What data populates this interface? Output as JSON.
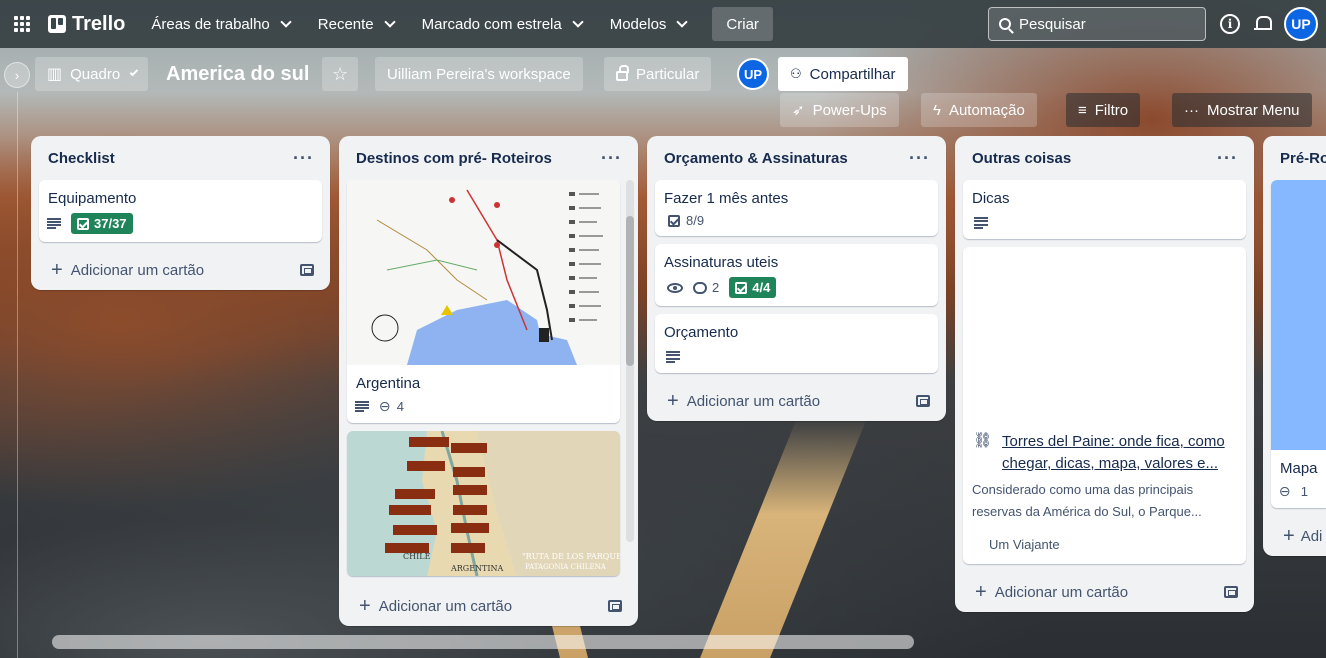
{
  "nav": {
    "logo_text": "Trello",
    "menu": [
      {
        "label": "Áreas de trabalho"
      },
      {
        "label": "Recente"
      },
      {
        "label": "Marcado com estrela"
      },
      {
        "label": "Modelos"
      }
    ],
    "create_label": "Criar",
    "search_placeholder": "Pesquisar",
    "avatar_initials": "UP"
  },
  "board": {
    "view_label": "Quadro",
    "title": "America do sul",
    "workspace_label": "Uilliam Pereira's workspace",
    "visibility_label": "Particular",
    "member_initials": "UP",
    "share_label": "Compartilhar",
    "powerups_label": "Power-Ups",
    "automation_label": "Automação",
    "filter_label": "Filtro",
    "menu_label": "Mostrar Menu"
  },
  "lists": {
    "add_card_label": "Adicionar um cartão",
    "checklist": {
      "title": "Checklist",
      "cards": [
        {
          "title": "Equipamento",
          "checklist": "37/37"
        }
      ]
    },
    "destinos": {
      "title": "Destinos com pré- Roteiros",
      "cards": [
        {
          "title": "Argentina",
          "attachments": "4"
        }
      ],
      "map2_labels": [
        "\"RUTA DE LOS PARQUES\"",
        "PATAGONIA CHILENA",
        "CHILE",
        "ARGENTINA"
      ]
    },
    "orcamento": {
      "title": "Orçamento & Assinaturas",
      "cards": [
        {
          "title": "Fazer 1 mês antes",
          "checklist": "8/9"
        },
        {
          "title": "Assinaturas uteis",
          "comments": "2",
          "checklist": "4/4"
        },
        {
          "title": "Orçamento"
        }
      ]
    },
    "outras": {
      "title": "Outras coisas",
      "cards": [
        {
          "title": "Dicas"
        },
        {
          "link_title": "Torres del Paine: onde fica, como chegar, dicas, mapa, valores e...",
          "link_desc": "Considerado como uma das principais reservas da América do Sul, o Parque...",
          "link_source": "Um Viajante"
        }
      ]
    },
    "preroteiro": {
      "title": "Pré-Ro",
      "cards": [
        {
          "title": "Mapa",
          "attachments": "1"
        }
      ],
      "add_label": "Adi"
    }
  },
  "colors": {
    "nav_bg": "#353f42",
    "list_bg": "#f1f2f4",
    "badge_complete": "#1f845a",
    "avatar_blue": "#0c66e4"
  }
}
